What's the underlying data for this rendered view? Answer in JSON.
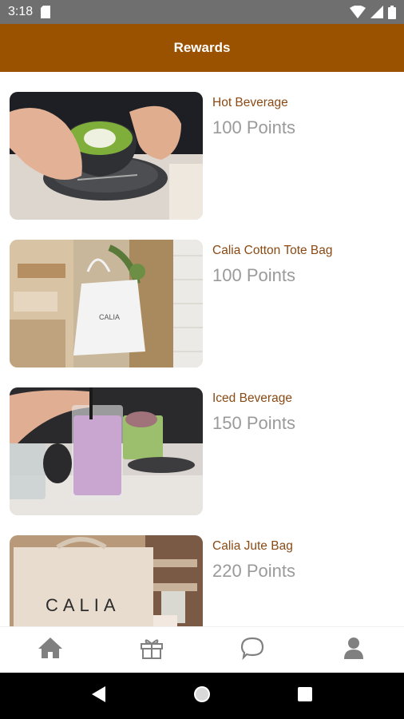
{
  "status_bar": {
    "time": "3:18"
  },
  "app_bar": {
    "title": "Rewards",
    "color": "#9a5100"
  },
  "rewards": [
    {
      "name": "Hot Beverage",
      "points": "100 Points",
      "image": "hot-beverage-photo"
    },
    {
      "name": "Calia Cotton Tote Bag",
      "points": "100 Points",
      "image": "cotton-tote-bag-photo"
    },
    {
      "name": "Iced Beverage",
      "points": "150 Points",
      "image": "iced-beverage-photo"
    },
    {
      "name": "Calia Jute Bag",
      "points": "220 Points",
      "image": "jute-bag-photo"
    }
  ],
  "bottom_nav": {
    "items": [
      {
        "icon": "home-icon"
      },
      {
        "icon": "gift-icon"
      },
      {
        "icon": "chat-icon"
      },
      {
        "icon": "profile-icon"
      }
    ],
    "icon_color": "#808080"
  },
  "images": {
    "tote_text": "CALIA",
    "jute_text": "CALIA"
  }
}
